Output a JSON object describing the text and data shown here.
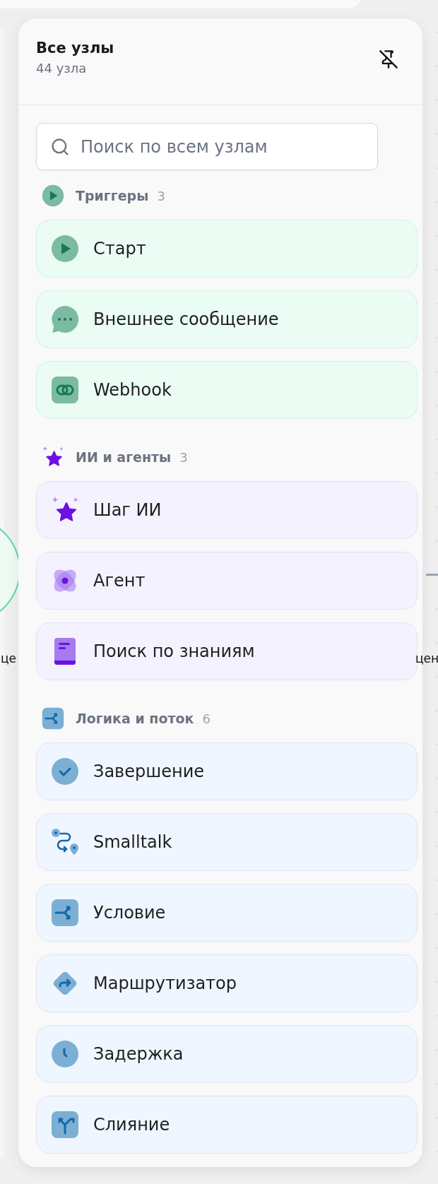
{
  "panel": {
    "title": "Все узлы",
    "subtitle": "44 узла",
    "search": {
      "placeholder": "Поиск по всем узлам"
    }
  },
  "groups": [
    {
      "kind": "triggers",
      "title": "Триггеры",
      "count": "3",
      "items": [
        {
          "label": "Старт"
        },
        {
          "label": "Внешнее сообщение"
        },
        {
          "label": "Webhook"
        }
      ]
    },
    {
      "kind": "ai",
      "title": "ИИ и агенты",
      "count": "3",
      "items": [
        {
          "label": "Шаг ИИ"
        },
        {
          "label": "Агент"
        },
        {
          "label": "Поиск по знаниям"
        }
      ]
    },
    {
      "kind": "logic",
      "title": "Логика и поток",
      "count": "6",
      "items": [
        {
          "label": "Завершение"
        },
        {
          "label": "Smalltalk"
        },
        {
          "label": "Условие"
        },
        {
          "label": "Маршрутизатор"
        },
        {
          "label": "Задержка"
        },
        {
          "label": "Слияние"
        }
      ]
    }
  ],
  "canvas_labels": [
    {
      "text": "це"
    },
    {
      "text": "цен"
    }
  ]
}
